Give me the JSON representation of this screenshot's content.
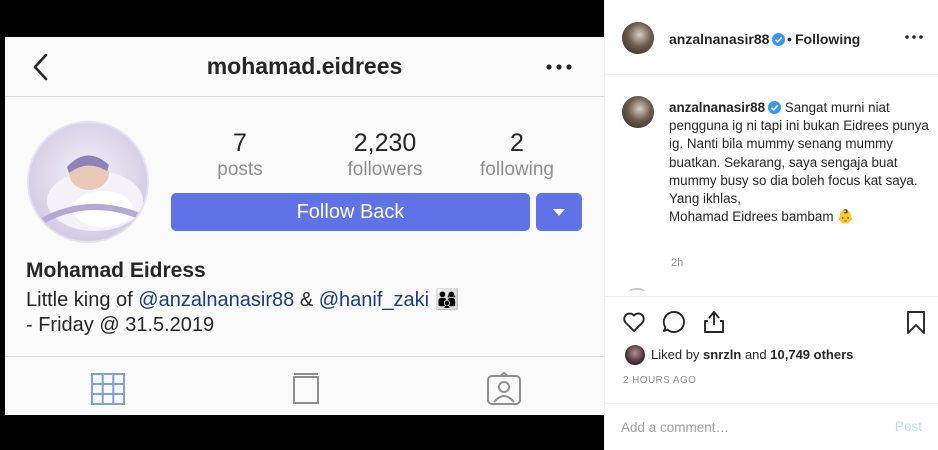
{
  "profile": {
    "username": "mohamad.eidrees",
    "stats": {
      "posts_count": "7",
      "posts_label": "posts",
      "followers_count": "2,230",
      "followers_label": "followers",
      "following_count": "2",
      "following_label": "following"
    },
    "follow_button": "Follow Back",
    "name": "Mohamad Eidress",
    "bio_prefix": "Little king of ",
    "bio_mention_1": "@anzalnanasir88",
    "bio_amp": " & ",
    "bio_mention_2": "@hanif_zaki",
    "bio_emoji": "👨‍👩‍👦",
    "bio_line2": "- Friday @ 31.5.2019"
  },
  "post": {
    "author": "anzalnanasir88",
    "separator": "•",
    "follow_status": "Following",
    "caption_author": "anzalnanasir88",
    "caption_text": "Sangat murni niat pengguna ig ni tapi ini bukan Eidrees punya ig. Nanti bila mummy senang mummy buatkan. Sekarang, saya sengaja buat mummy busy so dia boleh focus kat saya.",
    "caption_sign_1": "Yang ikhlas,",
    "caption_sign_2": "Mohamad Eidrees bambam",
    "caption_emoji": "👶",
    "caption_time": "2h",
    "liked_prefix": "Liked by ",
    "liked_user": "snrzln",
    "liked_middle": " and ",
    "liked_count": "10,749 others",
    "post_date": "2 HOURS AGO",
    "comment_placeholder": "Add a comment…",
    "post_button": "Post"
  },
  "colors": {
    "follow_blue": "#5f73e6",
    "verified_blue": "#3897f0",
    "mention_blue": "#1a3c82",
    "post_disabled": "#b2dffc"
  },
  "icons": {
    "back": "chevron-left-icon",
    "more": "more-horizontal-icon",
    "dropdown": "caret-down-icon",
    "grid": "grid-icon",
    "feed": "feed-icon",
    "tagged": "tagged-icon",
    "like": "heart-icon",
    "comment": "comment-icon",
    "share": "share-icon",
    "save": "bookmark-icon",
    "verified": "verified-badge-icon"
  }
}
